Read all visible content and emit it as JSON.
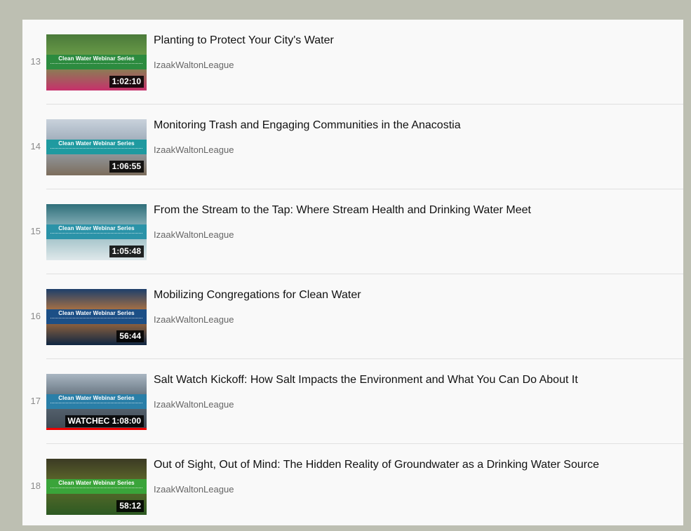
{
  "playlist": {
    "items": [
      {
        "index": "13",
        "title": "Planting to Protect Your City's Water",
        "channel": "IzaakWaltonLeague",
        "duration": "1:02:10",
        "series_label": "Clean Water Webinar Series",
        "band_color": "#2c8b3f",
        "scene": [
          "#4a7a3a",
          "#6fa04a",
          "#c7306b"
        ],
        "watched_progress": 0
      },
      {
        "index": "14",
        "title": "Monitoring Trash and Engaging Communities in the Anacostia",
        "channel": "IzaakWaltonLeague",
        "duration": "1:06:55",
        "series_label": "Clean Water Webinar Series",
        "band_color": "#1f9aa0",
        "scene": [
          "#c9d2dc",
          "#9aa8b6",
          "#7c6d5c"
        ],
        "watched_progress": 0
      },
      {
        "index": "15",
        "title": "From the Stream to the Tap: Where Stream Health and Drinking Water Meet",
        "channel": "IzaakWaltonLeague",
        "duration": "1:05:48",
        "series_label": "Clean Water Webinar Series",
        "band_color": "#2b93a8",
        "scene": [
          "#2f6f7a",
          "#8fb7bf",
          "#dfe8ea"
        ],
        "watched_progress": 0
      },
      {
        "index": "16",
        "title": "Mobilizing Congregations for Clean Water",
        "channel": "IzaakWaltonLeague",
        "duration": "56:44",
        "series_label": "Clean Water Webinar Series",
        "band_color": "#1c4f86",
        "scene": [
          "#1d3f6b",
          "#c37a3b",
          "#0f2642"
        ],
        "watched_progress": 0
      },
      {
        "index": "17",
        "title": "Salt Watch Kickoff: How Salt Impacts the Environment and What You Can Do About It",
        "channel": "IzaakWaltonLeague",
        "duration": "WATCHEC 1:08:00",
        "series_label": "Clean Water Webinar Series",
        "band_color": "#2a7fa8",
        "scene": [
          "#a9b6c2",
          "#5d6b77",
          "#3d4752"
        ],
        "watched_progress": 1
      },
      {
        "index": "18",
        "title": "Out of Sight, Out of Mind: The Hidden Reality of Groundwater as a Drinking Water Source",
        "channel": "IzaakWaltonLeague",
        "duration": "58:12",
        "series_label": "Clean Water Webinar Series",
        "band_color": "#3aa43a",
        "scene": [
          "#3b3a24",
          "#5f6b2b",
          "#2d5a22"
        ],
        "watched_progress": 0
      }
    ]
  }
}
